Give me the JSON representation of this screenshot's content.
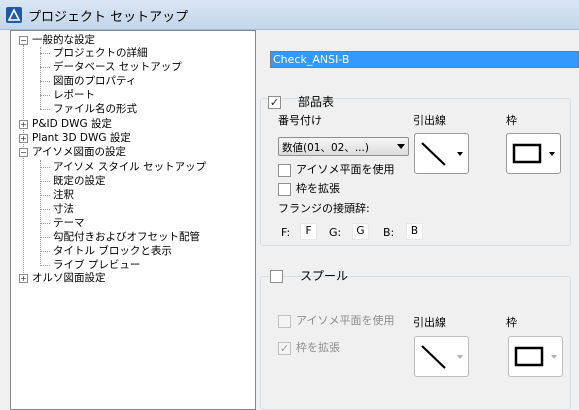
{
  "window": {
    "title": "プロジェクト セットアップ"
  },
  "tree": {
    "items": [
      {
        "label": "一般的な設定",
        "expander": "−"
      },
      {
        "label": "プロジェクトの詳細"
      },
      {
        "label": "データベース セットアップ"
      },
      {
        "label": "図面のプロパティ"
      },
      {
        "label": "レポート"
      },
      {
        "label": "ファイル名の形式"
      },
      {
        "label": "P&ID DWG 設定",
        "expander": "+"
      },
      {
        "label": "Plant 3D DWG 設定",
        "expander": "+"
      },
      {
        "label": "アイソメ図面の設定",
        "expander": "−"
      },
      {
        "label": "アイソメ スタイル セットアップ"
      },
      {
        "label": "既定の設定"
      },
      {
        "label": "注釈"
      },
      {
        "label": "寸法"
      },
      {
        "label": "テーマ"
      },
      {
        "label": "勾配付きおよびオフセット配管"
      },
      {
        "label": "タイトル ブロックと表示"
      },
      {
        "label": "ライブ プレビュー"
      },
      {
        "label": "オルソ図面設定",
        "expander": "+"
      }
    ]
  },
  "style_name": "Check_ANSI-B",
  "parts": {
    "checkbox_label": "部品表",
    "checked": true,
    "numbering_label": "番号付け",
    "numbering_value": "数値(01、02、...)",
    "leader_label": "引出線",
    "frame_label": "枠",
    "use_iso_plane_label": "アイソメ平面を使用",
    "use_iso_plane_checked": false,
    "expand_frame_label": "枠を拡張",
    "expand_frame_checked": false,
    "flange_prefix_label": "フランジの接頭辞:",
    "flange": [
      {
        "key": "F:",
        "value": "F"
      },
      {
        "key": "G:",
        "value": "G"
      },
      {
        "key": "B:",
        "value": "B"
      }
    ]
  },
  "spool": {
    "checkbox_label": "スプール",
    "checked": false,
    "use_iso_plane_label": "アイソメ平面を使用",
    "use_iso_plane_checked": false,
    "expand_frame_label": "枠を拡張",
    "expand_frame_checked": true,
    "leader_label": "引出線",
    "frame_label": "枠"
  },
  "icons": {
    "app": "autocad-plant-logo-icon",
    "leader": "diagonal-line-icon",
    "frame": "rectangle-frame-icon"
  }
}
